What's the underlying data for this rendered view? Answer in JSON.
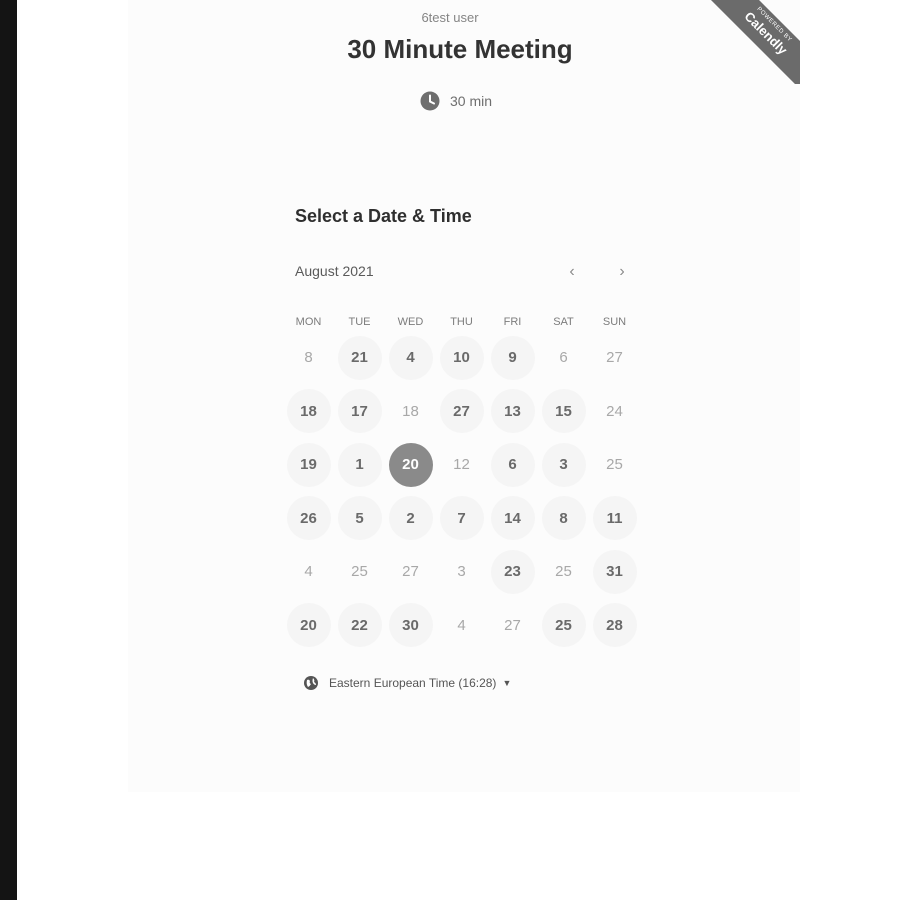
{
  "header": {
    "user_name": "6test user",
    "event_title": "30 Minute Meeting",
    "duration": "30 min"
  },
  "badge": {
    "line1": "POWERED BY",
    "line2": "Calendly"
  },
  "calendar": {
    "heading": "Select a Date & Time",
    "month_label": "August 2021",
    "weekdays": [
      "MON",
      "TUE",
      "WED",
      "THU",
      "FRI",
      "SAT",
      "SUN"
    ],
    "weeks": [
      [
        {
          "d": "8",
          "s": "unavailable"
        },
        {
          "d": "21",
          "s": "available"
        },
        {
          "d": "4",
          "s": "available"
        },
        {
          "d": "10",
          "s": "available"
        },
        {
          "d": "9",
          "s": "available"
        },
        {
          "d": "6",
          "s": "unavailable"
        },
        {
          "d": "27",
          "s": "unavailable"
        }
      ],
      [
        {
          "d": "18",
          "s": "available"
        },
        {
          "d": "17",
          "s": "available"
        },
        {
          "d": "18",
          "s": "unavailable"
        },
        {
          "d": "27",
          "s": "available"
        },
        {
          "d": "13",
          "s": "available"
        },
        {
          "d": "15",
          "s": "available"
        },
        {
          "d": "24",
          "s": "unavailable"
        }
      ],
      [
        {
          "d": "19",
          "s": "available"
        },
        {
          "d": "1",
          "s": "available"
        },
        {
          "d": "20",
          "s": "selected"
        },
        {
          "d": "12",
          "s": "unavailable"
        },
        {
          "d": "6",
          "s": "available"
        },
        {
          "d": "3",
          "s": "available"
        },
        {
          "d": "25",
          "s": "unavailable"
        }
      ],
      [
        {
          "d": "26",
          "s": "available"
        },
        {
          "d": "5",
          "s": "available"
        },
        {
          "d": "2",
          "s": "available"
        },
        {
          "d": "7",
          "s": "available"
        },
        {
          "d": "14",
          "s": "available"
        },
        {
          "d": "8",
          "s": "available"
        },
        {
          "d": "11",
          "s": "available"
        }
      ],
      [
        {
          "d": "4",
          "s": "unavailable"
        },
        {
          "d": "25",
          "s": "unavailable"
        },
        {
          "d": "27",
          "s": "unavailable"
        },
        {
          "d": "3",
          "s": "unavailable"
        },
        {
          "d": "23",
          "s": "available"
        },
        {
          "d": "25",
          "s": "unavailable"
        },
        {
          "d": "31",
          "s": "available"
        }
      ],
      [
        {
          "d": "20",
          "s": "available"
        },
        {
          "d": "22",
          "s": "available"
        },
        {
          "d": "30",
          "s": "available"
        },
        {
          "d": "4",
          "s": "unavailable"
        },
        {
          "d": "27",
          "s": "unavailable"
        },
        {
          "d": "25",
          "s": "available"
        },
        {
          "d": "28",
          "s": "available"
        }
      ]
    ]
  },
  "timezone": {
    "label": "Eastern European Time (16:28)"
  },
  "icons": {
    "duration": "clock-icon",
    "timezone": "globe-icon",
    "prev": "chevron-left-icon",
    "next": "chevron-right-icon",
    "dropdown": "caret-down-icon"
  },
  "colors": {
    "selected_day": "#8a8a8a",
    "available_day_bg": "#f5f5f5",
    "badge_bg": "#6b6b6b"
  }
}
